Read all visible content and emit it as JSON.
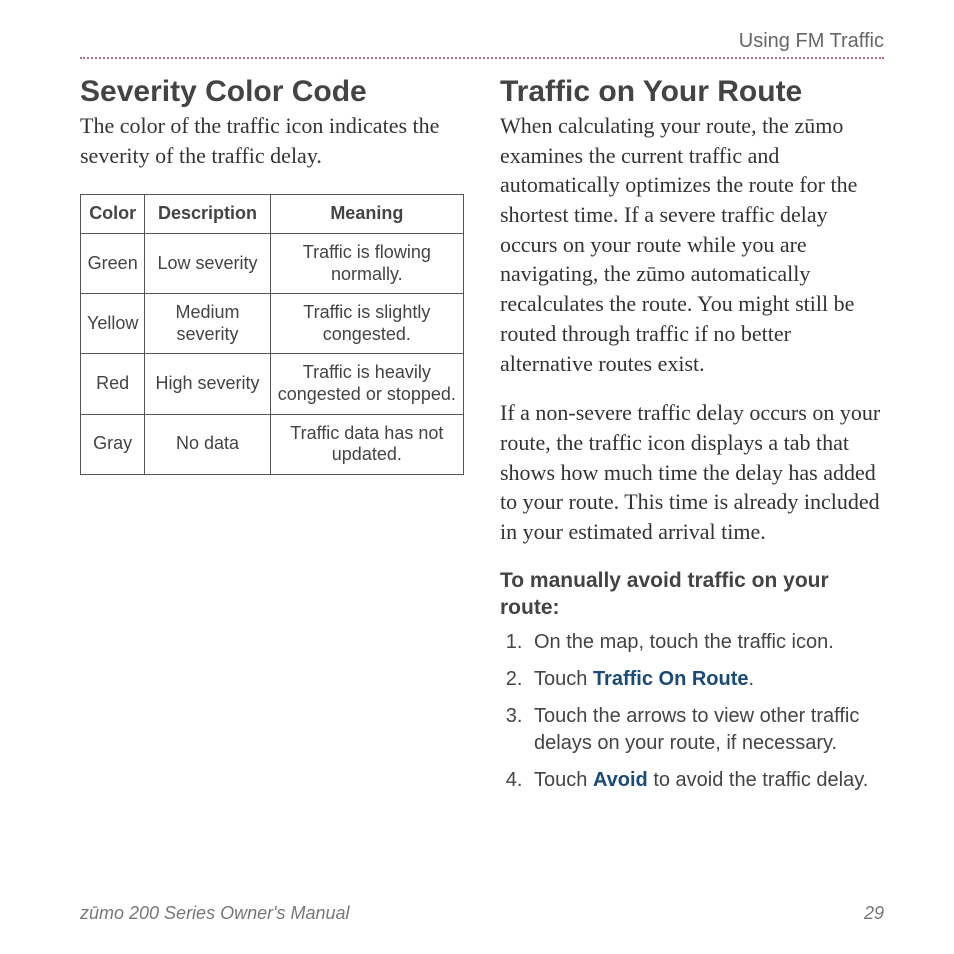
{
  "header": {
    "section": "Using FM Traffic"
  },
  "left": {
    "heading": "Severity Color Code",
    "intro": "The color of the traffic icon indicates the severity of the traffic delay.",
    "table": {
      "head": {
        "c1": "Color",
        "c2": "Description",
        "c3": "Meaning"
      },
      "rows": [
        {
          "c1": "Green",
          "c2": "Low severity",
          "c3": "Traffic is flowing normally."
        },
        {
          "c1": "Yellow",
          "c2": "Medium severity",
          "c3": "Traffic is slightly congested."
        },
        {
          "c1": "Red",
          "c2": "High severity",
          "c3": "Traffic is heavily congested or stopped."
        },
        {
          "c1": "Gray",
          "c2": "No data",
          "c3": "Traffic data has not updated."
        }
      ]
    }
  },
  "right": {
    "heading": "Traffic on Your Route",
    "p1": "When calculating your route, the zūmo examines the current traffic and automatically optimizes the route for the shortest time. If a severe traffic delay occurs on your route while you are navigating, the zūmo automatically recalculates the route. You might still be routed through traffic if no better alternative routes exist.",
    "p2": "If a non-severe traffic delay occurs on your route, the traffic icon displays a tab that shows how much time the delay has added to your route. This time is already included in your estimated arrival time.",
    "stepsTitle": "To manually avoid traffic on your route:",
    "steps": {
      "s1": "On the map, touch the traffic icon.",
      "s2a": "Touch ",
      "s2kw": "Traffic On Route",
      "s2b": ".",
      "s3": "Touch the arrows to view other traffic delays on your route, if necessary.",
      "s4a": "Touch ",
      "s4kw": "Avoid",
      "s4b": " to avoid the traffic delay."
    }
  },
  "footer": {
    "manual": "zūmo 200 Series Owner's Manual",
    "page": "29"
  }
}
